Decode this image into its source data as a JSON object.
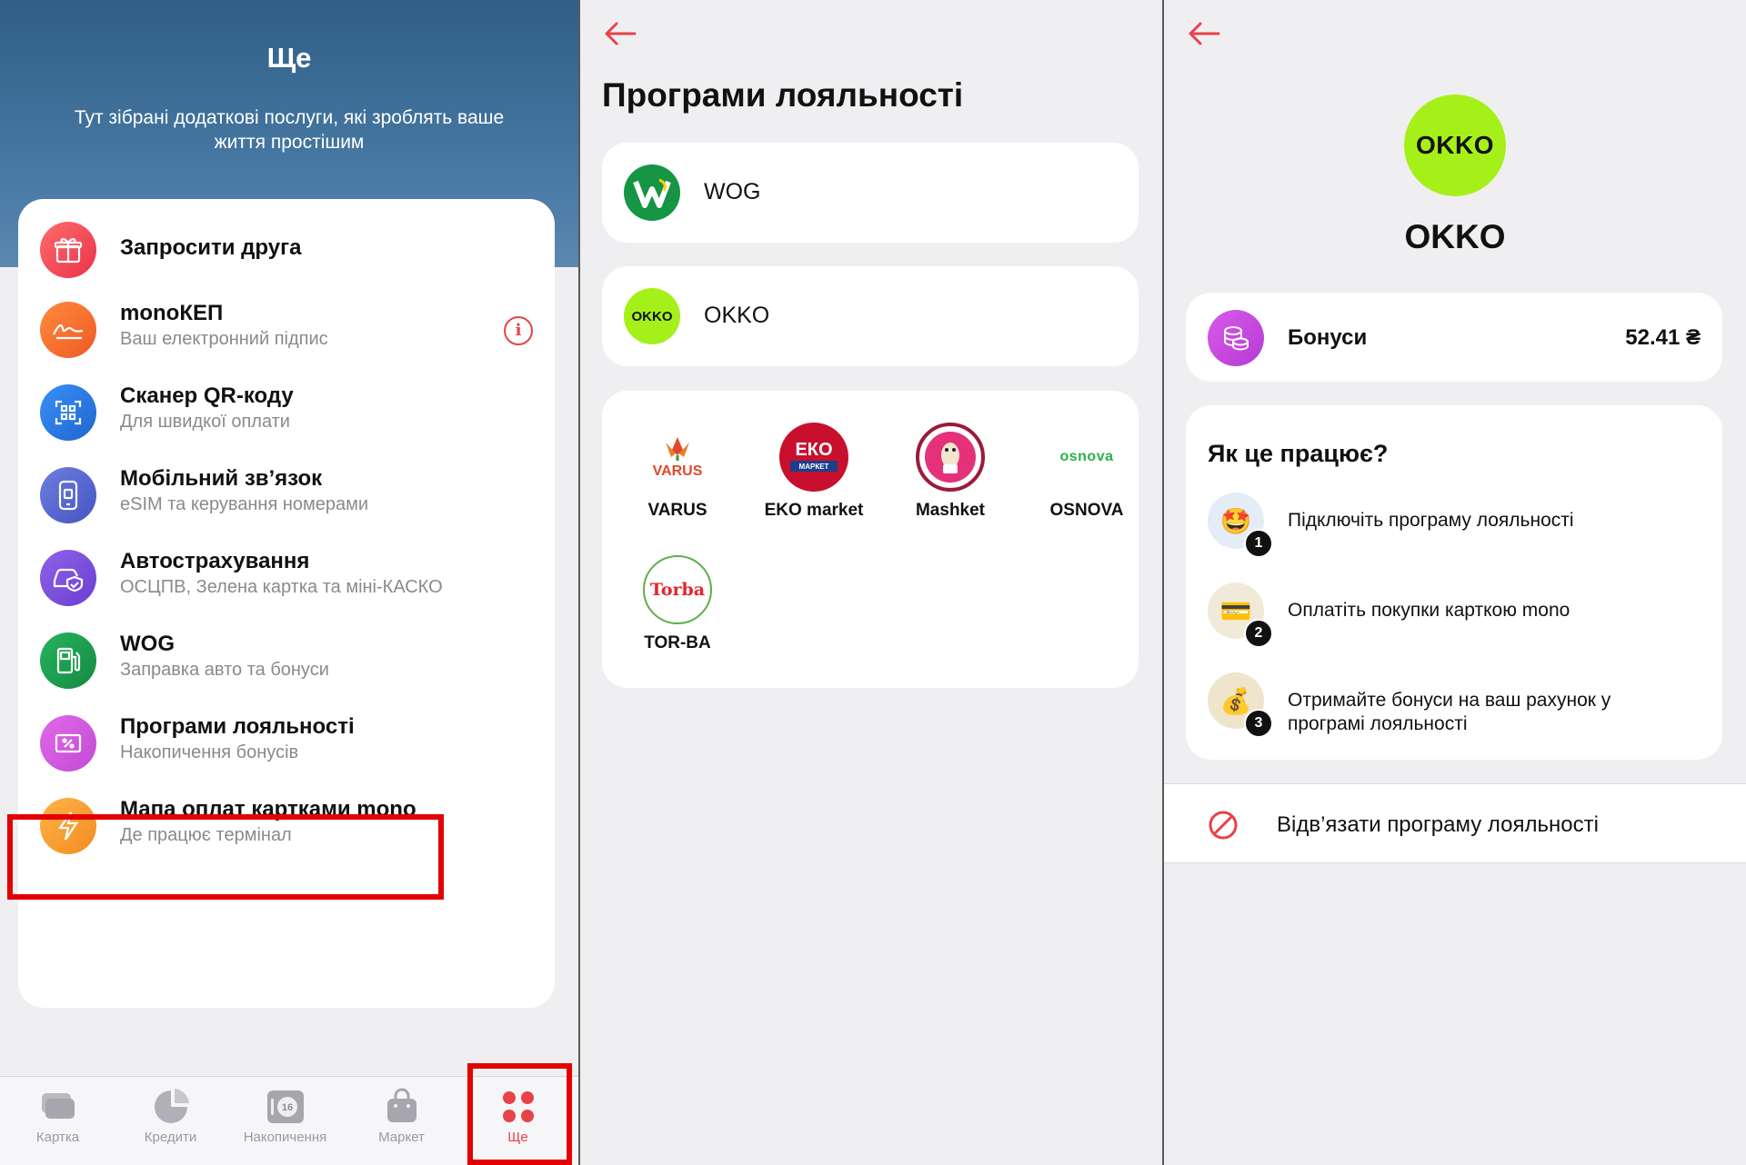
{
  "colors": {
    "accent": "#e84249",
    "highlight": "#e30000",
    "hero": "#3d6e98",
    "okko": "#a6f019",
    "wog": "#169544"
  },
  "panel1": {
    "title": "Ще",
    "subtitle": "Тут зібрані додаткові послуги, які зроблять ваше життя простішим",
    "services": [
      {
        "title": "Запросити друга",
        "subtitle": "",
        "icon": "gift-icon"
      },
      {
        "title": "monoКЕП",
        "subtitle": "Ваш електронний підпис",
        "icon": "signature-icon"
      },
      {
        "title": "Сканер QR-коду",
        "subtitle": "Для швидкої оплати",
        "icon": "qr-scanner-icon"
      },
      {
        "title": "Мобільний зв’язок",
        "subtitle": "eSIM та керування номерами",
        "icon": "phone-icon"
      },
      {
        "title": "Автострахування",
        "subtitle": "ОСЦПВ, Зелена картка та міні-КАСКО",
        "icon": "car-shield-icon"
      },
      {
        "title": "WOG",
        "subtitle": "Заправка авто та бонуси",
        "icon": "fuel-pump-icon"
      },
      {
        "title": "Програми лояльності",
        "subtitle": "Накопичення бонусів",
        "icon": "percent-card-icon"
      },
      {
        "title": "Мапа оплат картками mono",
        "subtitle": "Де працює термінал",
        "icon": "lightning-icon"
      }
    ],
    "info_glyph": "i",
    "tabs": [
      {
        "label": "Картка",
        "icon": "cards-icon"
      },
      {
        "label": "Кредити",
        "icon": "pie-chart-icon"
      },
      {
        "label": "Накопичення",
        "icon": "savings-icon",
        "badge": "16"
      },
      {
        "label": "Маркет",
        "icon": "bag-icon"
      },
      {
        "label": "Ще",
        "icon": "more-grid-icon",
        "active": true
      }
    ]
  },
  "panel2": {
    "title": "Програми лояльності",
    "programs": [
      {
        "name": "WOG",
        "logo_text": "W"
      },
      {
        "name": "OKKO",
        "logo_text": "OKKO"
      }
    ],
    "partners": [
      {
        "name": "VARUS",
        "logo_text": "VARUS"
      },
      {
        "name": "EKO market",
        "logo_text": "ЕКО",
        "logo_sub": "МАРКЕТ"
      },
      {
        "name": "Mashket",
        "logo_text": ""
      },
      {
        "name": "OSNOVA",
        "logo_text": "osnova"
      },
      {
        "name": "TOR-BA",
        "logo_text": "Torba"
      }
    ]
  },
  "panel3": {
    "logo_text": "OKKO",
    "name": "OKKO",
    "bonus_label": "Бонуси",
    "bonus_value": "52.41 ₴",
    "how_title": "Як це працює?",
    "steps": [
      {
        "num": "1",
        "text": "Підключіть програму лояльності",
        "emoji": "🤩"
      },
      {
        "num": "2",
        "text": "Оплатіть покупки карткою mono",
        "emoji": "💳"
      },
      {
        "num": "3",
        "text": "Отримайте бонуси на ваш рахунок у програмі лояльності",
        "emoji": "💰"
      }
    ],
    "unbind_label": "Відв’язати програму лояльності"
  }
}
